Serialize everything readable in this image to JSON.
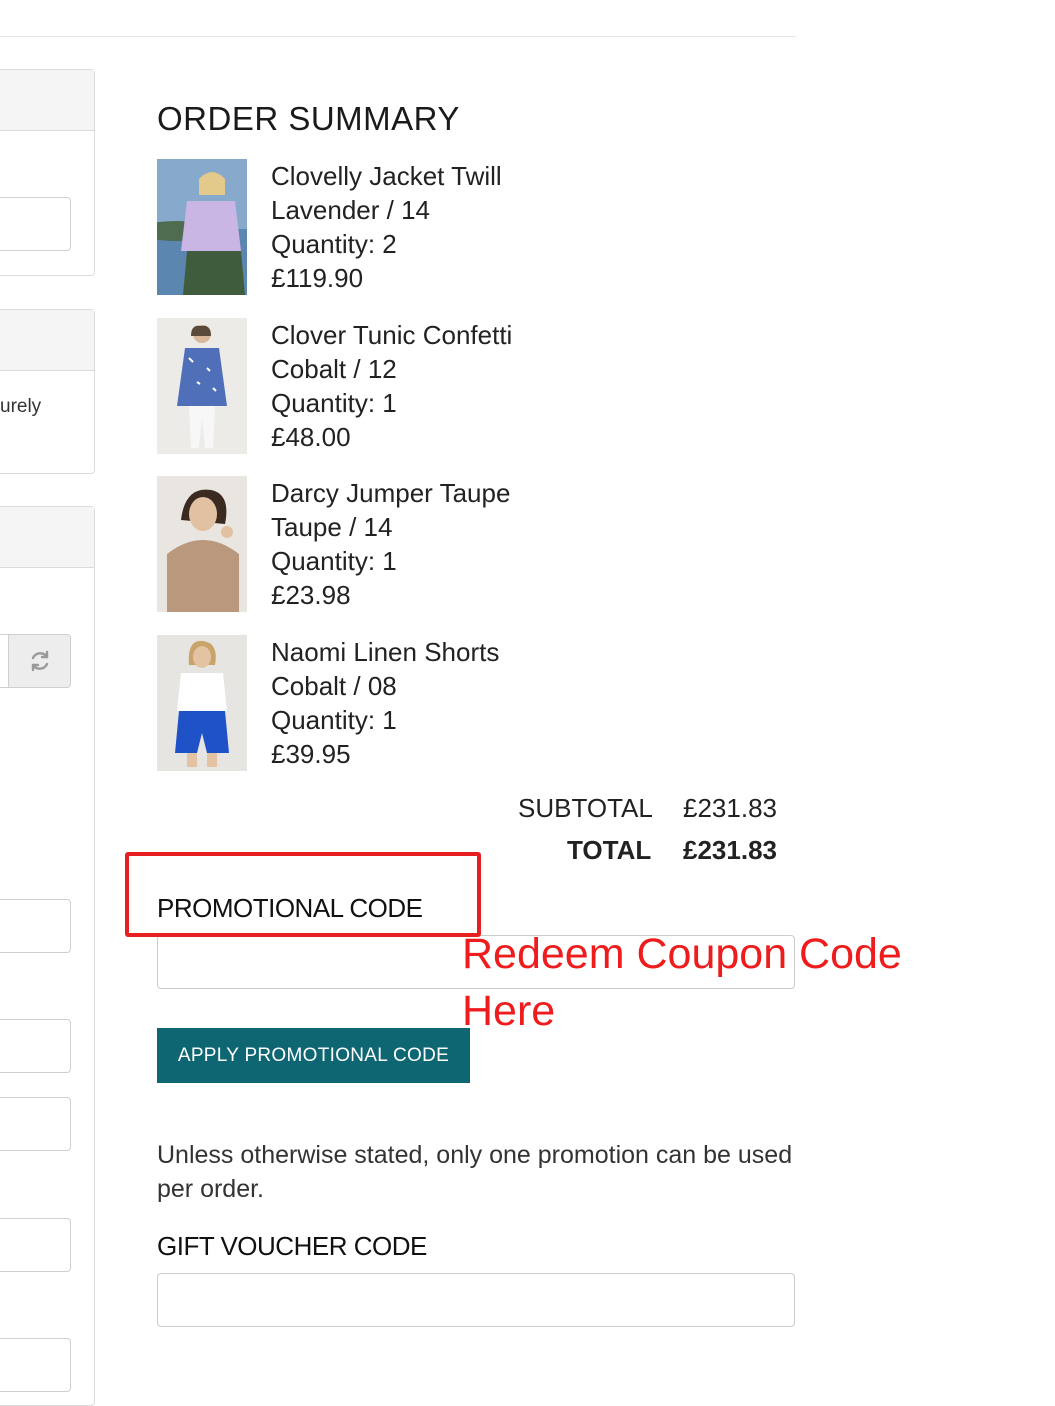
{
  "left_panel": {
    "visible_text_fragment": "urely"
  },
  "order_summary": {
    "title": "ORDER SUMMARY",
    "items": [
      {
        "name": "Clovelly Jacket Twill",
        "variant": "Lavender / 14",
        "quantity": "Quantity: 2",
        "price": "£119.90",
        "image_colors": {
          "bg": "#7fa3c4",
          "top": "#c9b6e4",
          "bottom": "#3d5a3a"
        }
      },
      {
        "name": "Clover Tunic Confetti",
        "variant": "Cobalt / 12",
        "quantity": "Quantity: 1",
        "price": "£48.00",
        "image_colors": {
          "bg": "#ecebe8",
          "top": "#5a7bbf",
          "bottom": "#f5f5f5"
        }
      },
      {
        "name": "Darcy Jumper Taupe",
        "variant": "Taupe / 14",
        "quantity": "Quantity: 1",
        "price": "£23.98",
        "image_colors": {
          "bg": "#e9e6e1",
          "top": "#b7957a",
          "bottom": "#8a6a52"
        }
      },
      {
        "name": "Naomi Linen Shorts",
        "variant": "Cobalt / 08",
        "quantity": "Quantity: 1",
        "price": "£39.95",
        "image_colors": {
          "bg": "#e6e5e2",
          "top": "#ffffff",
          "bottom": "#1c4fc4"
        }
      }
    ],
    "subtotal_label": "SUBTOTAL",
    "subtotal_value": "£231.83",
    "total_label": "TOTAL",
    "total_value": "£231.83"
  },
  "promo": {
    "label": "PROMOTIONAL CODE",
    "input_value": "",
    "button_label": "APPLY PROMOTIONAL CODE",
    "notice": "Unless otherwise stated, only one promotion can be used per order."
  },
  "gift_voucher": {
    "label": "GIFT VOUCHER CODE",
    "input_value": ""
  },
  "annotation": {
    "line1": "Redeem Coupon Code",
    "line2": "Here"
  },
  "colors": {
    "accent": "#0f6673",
    "annotation": "#e62020"
  },
  "icons": {
    "refresh": "refresh-icon"
  }
}
